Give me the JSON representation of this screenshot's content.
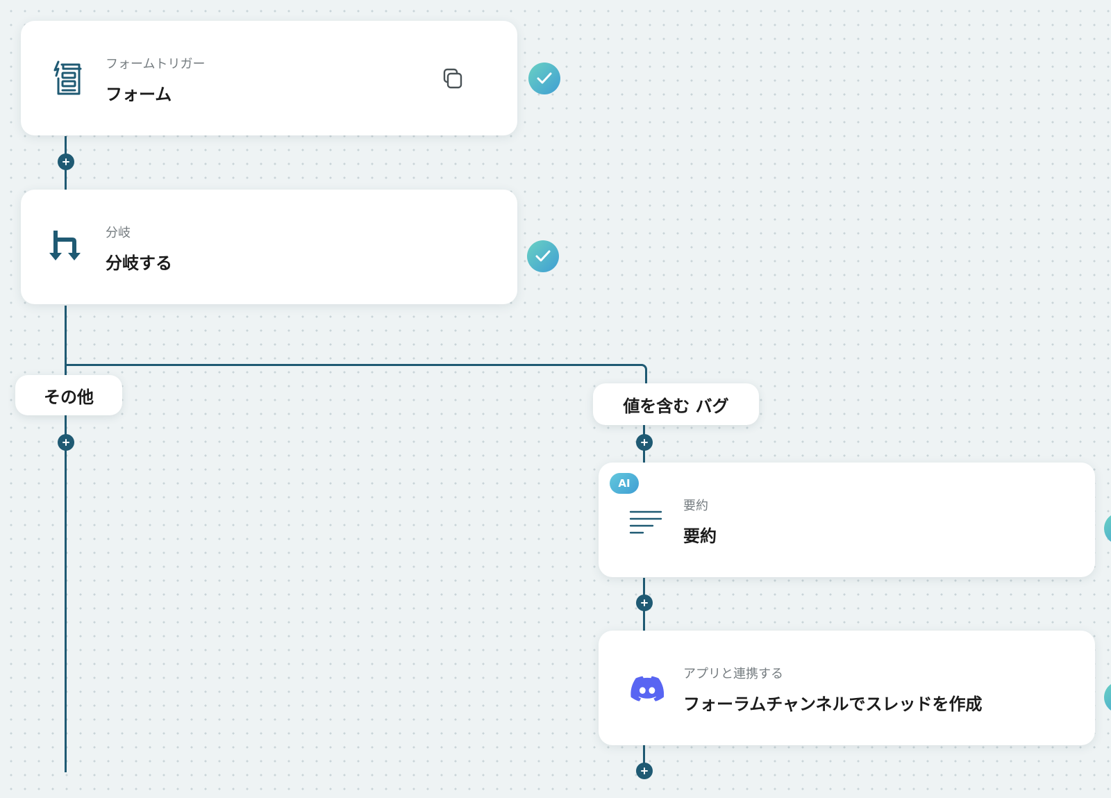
{
  "nodes": {
    "form_trigger": {
      "category": "フォームトリガー",
      "title": "フォーム",
      "icon": "form-icon"
    },
    "branch": {
      "category": "分岐",
      "title": "分岐する",
      "icon": "branch-icon"
    },
    "summary": {
      "badge": "AI",
      "category": "要約",
      "title": "要約",
      "icon": "summary-lines-icon"
    },
    "discord_action": {
      "category": "アプリと連携する",
      "title": "フォーラムチャンネルでスレッドを作成",
      "icon": "discord-icon"
    }
  },
  "branches": {
    "other_label": "その他",
    "condition_label": "値を含む バグ"
  },
  "colors": {
    "line": "#1f5a73",
    "check_gradient_start": "#6ad1c3",
    "check_gradient_end": "#3f9ed3",
    "discord": "#5865f2",
    "background": "#eef3f4"
  }
}
